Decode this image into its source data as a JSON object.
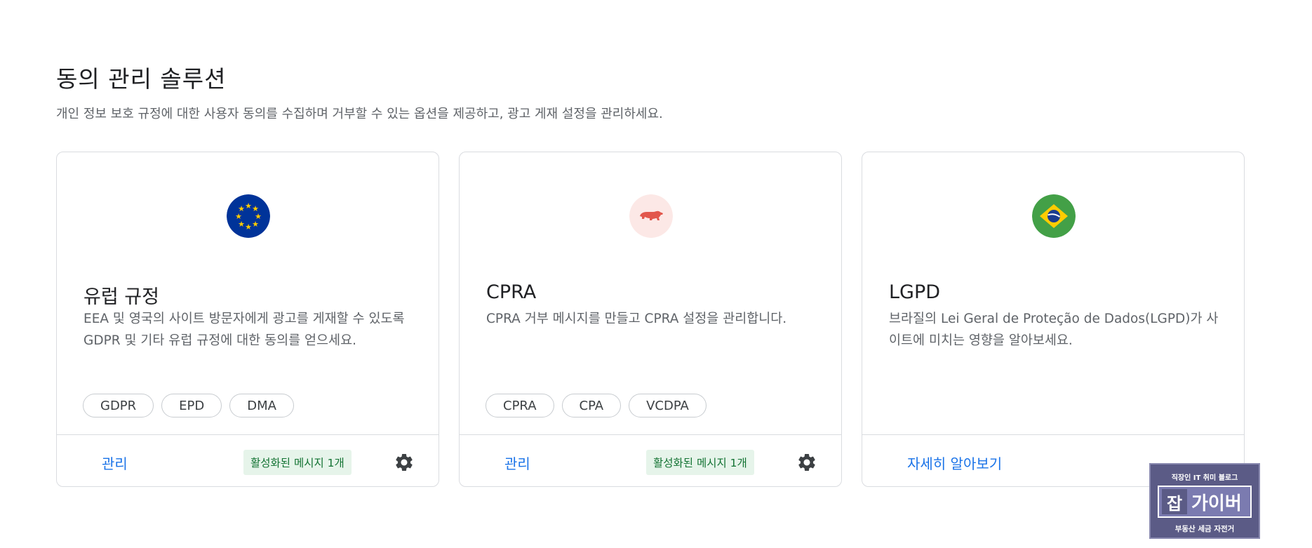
{
  "header": {
    "title": "동의 관리 솔루션",
    "description": "개인 정보 보호 규정에 대한 사용자 동의를 수집하며 거부할 수 있는 옵션을 제공하고, 광고 게재 설정을 관리하세요."
  },
  "cards": [
    {
      "icon": "eu-flag-icon",
      "title": "유럽 규정",
      "description": "EEA 및 영국의 사이트 방문자에게 광고를 게재할 수 있도록 GDPR 및 기타 유럽 규정에 대한 동의를 얻으세요.",
      "chips": [
        "GDPR",
        "EPD",
        "DMA"
      ],
      "link": "관리",
      "badge": "활성화된 메시지 1개"
    },
    {
      "icon": "california-bear-icon",
      "title": "CPRA",
      "description": "CPRA 거부 메시지를 만들고 CPRA 설정을 관리합니다.",
      "chips": [
        "CPRA",
        "CPA",
        "VCDPA"
      ],
      "link": "관리",
      "badge": "활성화된 메시지 1개"
    },
    {
      "icon": "brazil-flag-icon",
      "title": "LGPD",
      "description": "브라질의 Lei Geral de Proteção de Dados(LGPD)가 사이트에 미치는 영향을 알아보세요.",
      "link": "자세히 알아보기"
    }
  ],
  "watermark": {
    "top": "직장인 IT 취미 블로그",
    "logo_char": "잡",
    "logo_name": "가이버",
    "bottom": "부동산 세금 자전거"
  },
  "colors": {
    "link": "#1a73e8",
    "badge_bg": "#e6f4ea",
    "badge_text": "#137333",
    "eu_blue": "#003399",
    "eu_gold": "#ffcc00",
    "bear_red": "#e2574c",
    "brazil_green": "#43a047"
  }
}
